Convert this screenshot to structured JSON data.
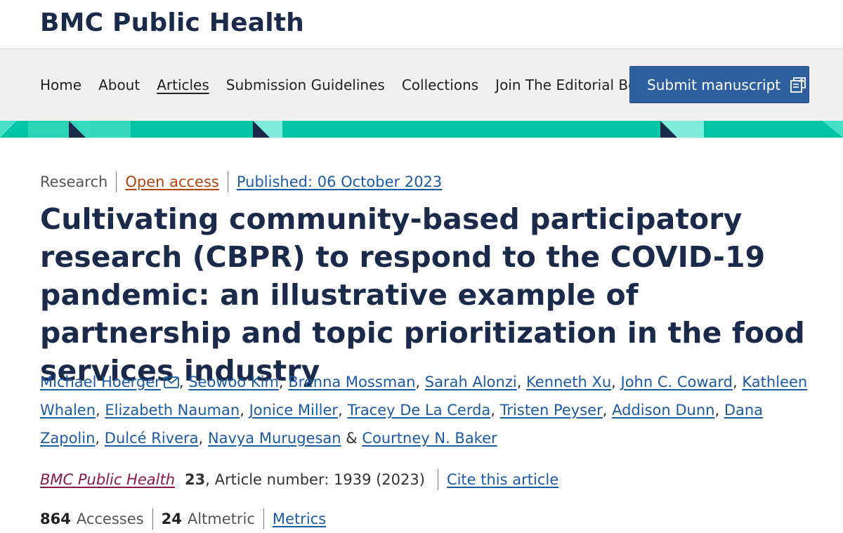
{
  "header": {
    "journal_title": "BMC Public Health"
  },
  "nav": {
    "items": [
      {
        "label": "Home"
      },
      {
        "label": "About"
      },
      {
        "label": "Articles"
      },
      {
        "label": "Submission Guidelines"
      },
      {
        "label": "Collections"
      },
      {
        "label": "Join The Editorial Board"
      }
    ],
    "submit_label": "Submit manuscript",
    "submit_icon": "submit-manuscript-icon"
  },
  "colors": {
    "brand_navy": "#1a2a4a",
    "teal_band": "#00c5a5",
    "button_blue": "#2e5f9e",
    "link_blue": "#1a5aa6",
    "open_access_orange": "#b4430e",
    "journal_link": "#8a1a4a"
  },
  "article": {
    "type": "Research",
    "open_access": "Open access",
    "published": "Published: 06 October 2023",
    "title": "Cultivating community-based participatory research (CBPR) to respond to the COVID-19 pandemic: an illustrative example of partnership and topic prioritization in the food services industry",
    "authors": [
      "Michael Hoerger",
      "Seowoo Kim",
      "Brenna Mossman",
      "Sarah Alonzi",
      "Kenneth Xu",
      "John C. Coward",
      "Kathleen Whalen",
      "Elizabeth Nauman",
      "Jonice Miller",
      "Tracey De La Cerda",
      "Tristen Peyser",
      "Addison Dunn",
      "Dana Zapolin",
      "Dulcé Rivera",
      "Navya Murugesan",
      "Courtney N. Baker"
    ],
    "corresponding_icon": "mail-icon",
    "journal": "BMC Public Health",
    "volume": "23",
    "article_number_text": ", Article number: 1939 (2023)",
    "cite_label": "Cite this article",
    "accesses_count": "864",
    "accesses_label": "Accesses",
    "altmetric_count": "24",
    "altmetric_label": "Altmetric",
    "metrics_label": "Metrics"
  }
}
